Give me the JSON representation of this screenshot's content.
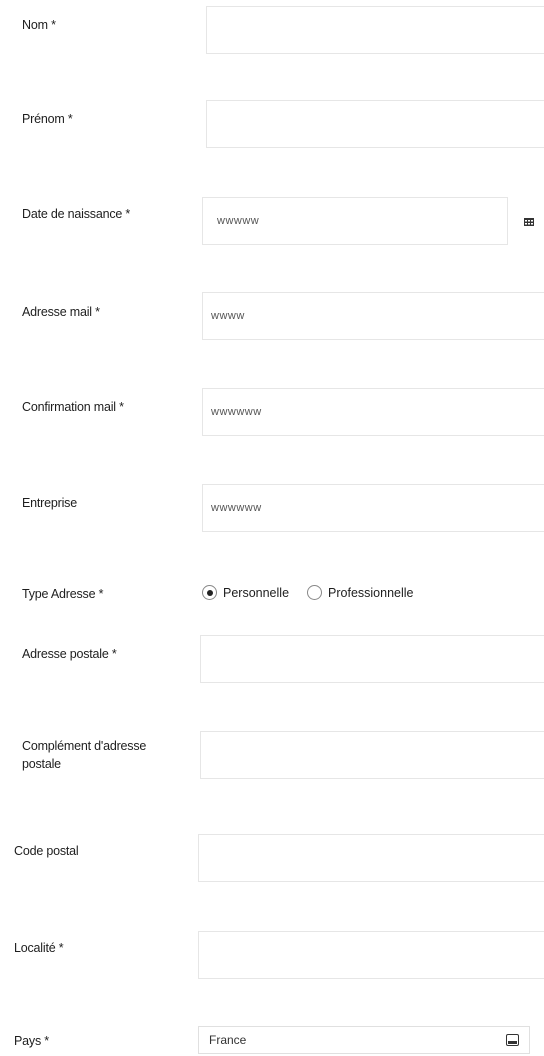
{
  "form": {
    "nom": {
      "label": "Nom *",
      "value": ""
    },
    "prenom": {
      "label": "Prénom *",
      "value": ""
    },
    "date_naissance": {
      "label": "Date de naissance *",
      "value": "wwwww",
      "icon": "calendar-icon"
    },
    "adresse_mail": {
      "label": "Adresse mail *",
      "value": "wwww"
    },
    "confirmation_mail": {
      "label": "Confirmation mail *",
      "value": "wwwwww"
    },
    "entreprise": {
      "label": "Entreprise",
      "value": "wwwwww"
    },
    "type_adresse": {
      "label": "Type Adresse *",
      "options": [
        "Personnelle",
        "Professionnelle"
      ],
      "selected": "Personnelle"
    },
    "adresse_postale": {
      "label": "Adresse postale *",
      "value": ""
    },
    "complement": {
      "label_line1": "Complément d'adresse",
      "label_line2": "postale",
      "value": ""
    },
    "code_postal": {
      "label": "Code postal",
      "value": ""
    },
    "localite": {
      "label": "Localité *",
      "value": ""
    },
    "pays": {
      "label": "Pays *",
      "value": "France",
      "icon": "dropdown-icon"
    }
  }
}
